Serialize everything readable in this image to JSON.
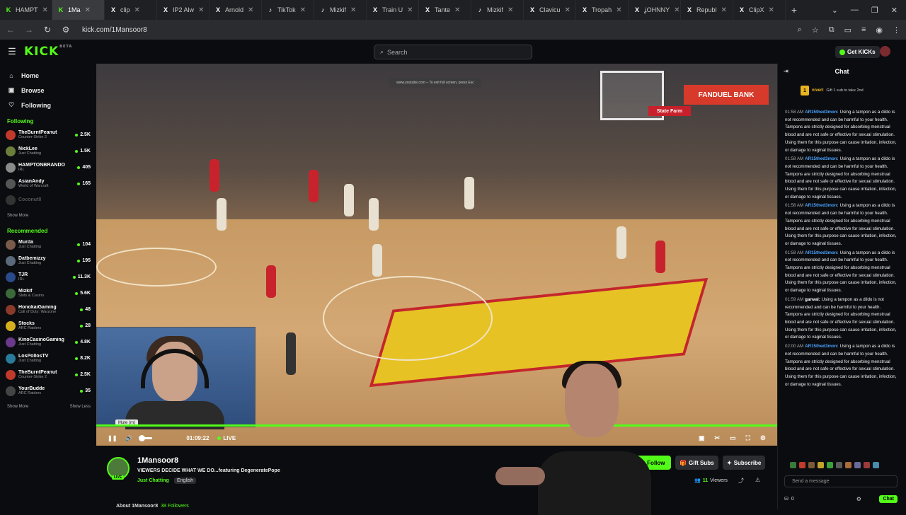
{
  "browser": {
    "tabs": [
      {
        "label": "HAMPT",
        "fav": "K",
        "color": "#53fc18"
      },
      {
        "label": "1Ma",
        "fav": "K",
        "color": "#53fc18",
        "active": true
      },
      {
        "label": "clip",
        "fav": "X",
        "color": "#fff"
      },
      {
        "label": "IP2 Alw",
        "fav": "X",
        "color": "#fff"
      },
      {
        "label": "Arnold",
        "fav": "X",
        "color": "#fff"
      },
      {
        "label": "TikTok",
        "fav": "♪",
        "color": "#fff"
      },
      {
        "label": "Mizkif",
        "fav": "♪",
        "color": "#fff"
      },
      {
        "label": "Train U",
        "fav": "X",
        "color": "#fff"
      },
      {
        "label": "Tante",
        "fav": "X",
        "color": "#fff"
      },
      {
        "label": "Mizkif",
        "fav": "♪",
        "color": "#fff"
      },
      {
        "label": "Clavicu",
        "fav": "X",
        "color": "#fff"
      },
      {
        "label": "Tropah",
        "fav": "X",
        "color": "#fff"
      },
      {
        "label": "ʝOHNNY",
        "fav": "X",
        "color": "#fff"
      },
      {
        "label": "Republ",
        "fav": "X",
        "color": "#fff"
      },
      {
        "label": "ClipX",
        "fav": "X",
        "color": "#fff"
      }
    ],
    "url": "kick.com/1Mansoor8"
  },
  "header": {
    "logo": "KICK",
    "logo_beta": "BETA",
    "search_placeholder": "Search",
    "get_kicks": "Get KICKs"
  },
  "sidebar": {
    "nav": [
      {
        "label": "Home",
        "icon": "home-icon"
      },
      {
        "label": "Browse",
        "icon": "browse-icon"
      },
      {
        "label": "Following",
        "icon": "heart-icon"
      }
    ],
    "following_title": "Following",
    "following": [
      {
        "name": "TheBurntPeanut",
        "cat": "Counter-Strike 2",
        "viewers": "2.5K",
        "color": "#c0392b"
      },
      {
        "name": "NickLee",
        "cat": "Just Chatting",
        "viewers": "1.5K",
        "color": "#6b7f3a"
      },
      {
        "name": "HAMPTONBRANDO",
        "cat": "IRL",
        "viewers": "405",
        "color": "#8a8a8a"
      },
      {
        "name": "AsianAndy",
        "cat": "World of Warcraft",
        "viewers": "165",
        "color": "#555"
      },
      {
        "name": "Coconut8",
        "cat": "",
        "viewers": "",
        "color": "#333",
        "offline": true
      }
    ],
    "show_more_1": "Show More",
    "recommended_title": "Recommended",
    "recommended": [
      {
        "name": "Murda",
        "cat": "Just Chatting",
        "viewers": "104",
        "color": "#7a5a4a"
      },
      {
        "name": "Datbemizzy",
        "cat": "Just Chatting",
        "viewers": "195",
        "color": "#5a6a7a"
      },
      {
        "name": "TJR",
        "cat": "IRL",
        "viewers": "11.3K",
        "color": "#2a4a8a"
      },
      {
        "name": "Mizkif",
        "cat": "Slots & Casino",
        "viewers": "5.6K",
        "color": "#3a6a3a"
      },
      {
        "name": "HonokaiGaming",
        "cat": "Call of Duty: Warzone",
        "viewers": "48",
        "color": "#8a3a2a"
      },
      {
        "name": "Stocks",
        "cat": "ARC Raiders",
        "viewers": "28",
        "color": "#d4b020"
      },
      {
        "name": "KinoCasinoGaming",
        "cat": "Just Chatting",
        "viewers": "4.8K",
        "color": "#6a3a8a"
      },
      {
        "name": "LosPollosTV",
        "cat": "Just Chatting",
        "viewers": "8.2K",
        "color": "#2a7a9a"
      },
      {
        "name": "TheBurntPeanut",
        "cat": "Counter-Strike 2",
        "viewers": "2.5K",
        "color": "#c0392b"
      },
      {
        "name": "YourBudde",
        "cat": "ARC Raiders",
        "viewers": "35",
        "color": "#444"
      }
    ],
    "show_more_2": "Show More",
    "show_less": "Show Less"
  },
  "video": {
    "yt_notice": "www.youtube.com – To exit full screen, press Esc",
    "ad_text": "FANDUEL BANK",
    "ad2_text": "State Farm",
    "tooltip": "Mute (m)",
    "timecode": "01:09:22",
    "live_label": "LIVE"
  },
  "stream": {
    "channel": "1Mansoor8",
    "live_badge": "LIVE",
    "title": "VIEWERS DECIDE WHAT WE DO...featuring DegeneratePope",
    "category": "Just Chatting",
    "language": "English",
    "follow": "Follow",
    "gift_subs": "Gift Subs",
    "subscribe": "Subscribe",
    "viewers_count": "11",
    "viewers_label": "Viewers",
    "about": "About 1Mansoor8",
    "followers": "38 Followers"
  },
  "chat": {
    "title": "Chat",
    "pinned_badge": "1",
    "pinned_user": "nivert",
    "pinned_text": "Gift 1 sub to take 2nd",
    "messages": [
      {
        "ts": "01:58 AM",
        "user": "AR15thed3mon:",
        "color": "#4aa3ff",
        "text": "Using a tampon as a dildo is not recommended and can be harmful to your health. Tampons are strictly designed for absorbing menstrual blood and are not safe or effective for sexual stimulation. Using them for this purpose can cause irritation, infection, or damage to vaginal tissues."
      },
      {
        "ts": "01:58 AM",
        "user": "AR15thed3mon:",
        "color": "#4aa3ff",
        "text": "Using a tampon as a dildo is not recommended and can be harmful to your health. Tampons are strictly designed for absorbing menstrual blood and are not safe or effective for sexual stimulation. Using them for this purpose can cause irritation, infection, or damage to vaginal tissues."
      },
      {
        "ts": "01:58 AM",
        "user": "AR15thed3mon:",
        "color": "#4aa3ff",
        "text": "Using a tampon as a dildo is not recommended and can be harmful to your health. Tampons are strictly designed for absorbing menstrual blood and are not safe or effective for sexual stimulation. Using them for this purpose can cause irritation, infection, or damage to vaginal tissues."
      },
      {
        "ts": "01:58 AM",
        "user": "AR15thed3mon:",
        "color": "#4aa3ff",
        "text": "Using a tampon as a dildo is not recommended and can be harmful to your health. Tampons are strictly designed for absorbing menstrual blood and are not safe or effective for sexual stimulation. Using them for this purpose can cause irritation, infection, or damage to vaginal tissues."
      },
      {
        "ts": "01:59 AM",
        "user": "ganval:",
        "color": "#ffffff",
        "text": "Using a tampon as a dildo is not recommended and can be harmful to your health. Tampons are strictly designed for absorbing menstrual blood and are not safe or effective for sexual stimulation. Using them for this purpose can cause irritation, infection, or damage to vaginal tissues."
      },
      {
        "ts": "02:00 AM",
        "user": "AR15thed3mon:",
        "color": "#4aa3ff",
        "text": "Using a tampon as a dildo is not recommended and can be harmful to your health. Tampons are strictly designed for absorbing menstrual blood and are not safe or effective for sexual stimulation. Using them for this purpose can cause irritation, infection, or damage to vaginal tissues."
      }
    ],
    "input_placeholder": "Send a message",
    "kicks_count": "0",
    "chat_button": "Chat"
  }
}
